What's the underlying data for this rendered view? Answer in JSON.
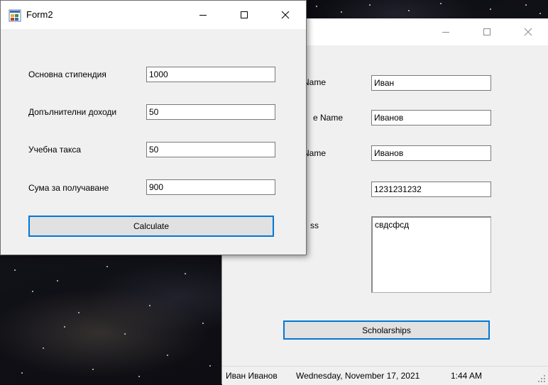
{
  "form1": {
    "fields": [
      {
        "label": "Name",
        "value": "Иван"
      },
      {
        "label": "e Name",
        "value": "Иванов"
      },
      {
        "label": "Name",
        "value": "Иванов"
      },
      {
        "label": "",
        "value": "1231231232"
      }
    ],
    "address_label": "ss",
    "address_value": "свдсфсд",
    "scholarships_button": "Scholarships",
    "status": {
      "user": "Иван Иванов",
      "date": "Wednesday, November 17, 2021",
      "time": "1:44 AM"
    }
  },
  "form2": {
    "title": "Form2",
    "rows": [
      {
        "label": "Основна стипендия",
        "value": "1000"
      },
      {
        "label": "Допълнителни доходи",
        "value": "50"
      },
      {
        "label": "Учебна такса",
        "value": "50"
      },
      {
        "label": "Сума за получаване",
        "value": "900"
      }
    ],
    "calculate_button": "Calculate"
  },
  "icons": {
    "minimize": "minimize-icon",
    "maximize": "maximize-icon",
    "close": "close-icon",
    "app": "form-app-icon"
  }
}
